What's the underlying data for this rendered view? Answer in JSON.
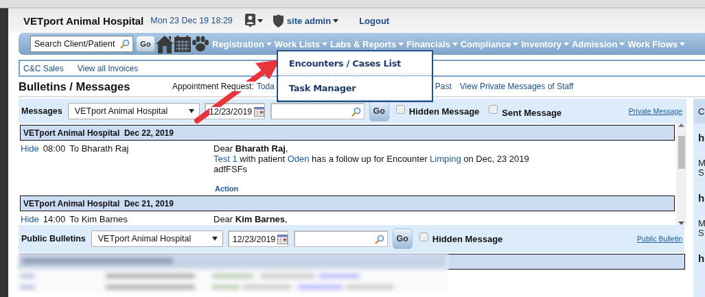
{
  "header": {
    "hospital": "VETport Animal Hospital",
    "datetime": "Mon 23 Dec 19 18:29",
    "user": "site admin",
    "logout": "Logout"
  },
  "nav": {
    "search_placeholder": "Search Client/Patient",
    "go": "Go",
    "menus": [
      {
        "label": "Registration"
      },
      {
        "label": "Work Lists",
        "items": [
          "Encounters / Cases List",
          "Task Manager"
        ]
      },
      {
        "label": "Labs & Reports"
      },
      {
        "label": "Financials"
      },
      {
        "label": "Compliance"
      },
      {
        "label": "Inventory"
      },
      {
        "label": "Admission"
      },
      {
        "label": "Work Flows"
      }
    ]
  },
  "subnav": [
    "C&C Sales",
    "View all Invoices"
  ],
  "page_title": "Bulletins / Messages",
  "appointment": {
    "label": "Appointment Request:",
    "links": [
      "Toda",
      "Past",
      "View Private Messages of Staff"
    ]
  },
  "messages": {
    "toolbar": {
      "label": "Messages",
      "location": "VETport Animal Hospital",
      "date": "12/23/2019",
      "go": "Go",
      "checkboxes": [
        {
          "label": "Hidden Message",
          "checked": false
        },
        {
          "label": "Sent Message",
          "checked": false
        }
      ],
      "link": "Private Message"
    },
    "groups": [
      {
        "title": "VETport Animal Hospital  Dec 22, 2019",
        "rows": [
          {
            "hide": "Hide",
            "time": "08:00",
            "to": "To Bharath Raj",
            "greeting": "Dear **Bharath Raj**,",
            "body": [
              {
                "kind": "link",
                "text": "Test 1"
              },
              {
                "kind": "plain",
                "text": " with patient "
              },
              {
                "kind": "link",
                "text": "Oden"
              },
              {
                "kind": "plain",
                "text": " has a follow up for Encounter "
              },
              {
                "kind": "link",
                "text": "Limping"
              },
              {
                "kind": "plain",
                "text": " on Dec, 23 2019"
              }
            ],
            "note": "adfFSFs",
            "action": "Action"
          }
        ]
      },
      {
        "title": "VETport Animal Hospital  Dec 21, 2019",
        "rows": [
          {
            "hide": "Hide",
            "time": "14:00",
            "to": "To Kim Barnes",
            "greeting": "Dear **Kim Barnes**,"
          }
        ]
      }
    ]
  },
  "public_bulletins": {
    "toolbar": {
      "label": "Public Bulletins",
      "location": "VETport Animal Hospital",
      "date": "12/23/2019",
      "go": "Go",
      "checkboxes": [
        {
          "label": "Hidden Message",
          "checked": false
        }
      ],
      "link": "Public Bulletin"
    },
    "groups": [
      {
        "blurred": true
      }
    ]
  },
  "side_panel": {
    "header": "C",
    "items": [
      {
        "title": "h",
        "lines": [
          "M",
          "S"
        ]
      },
      {
        "title": "h",
        "lines": [
          "M",
          "S"
        ]
      },
      {
        "title": "h"
      }
    ]
  }
}
